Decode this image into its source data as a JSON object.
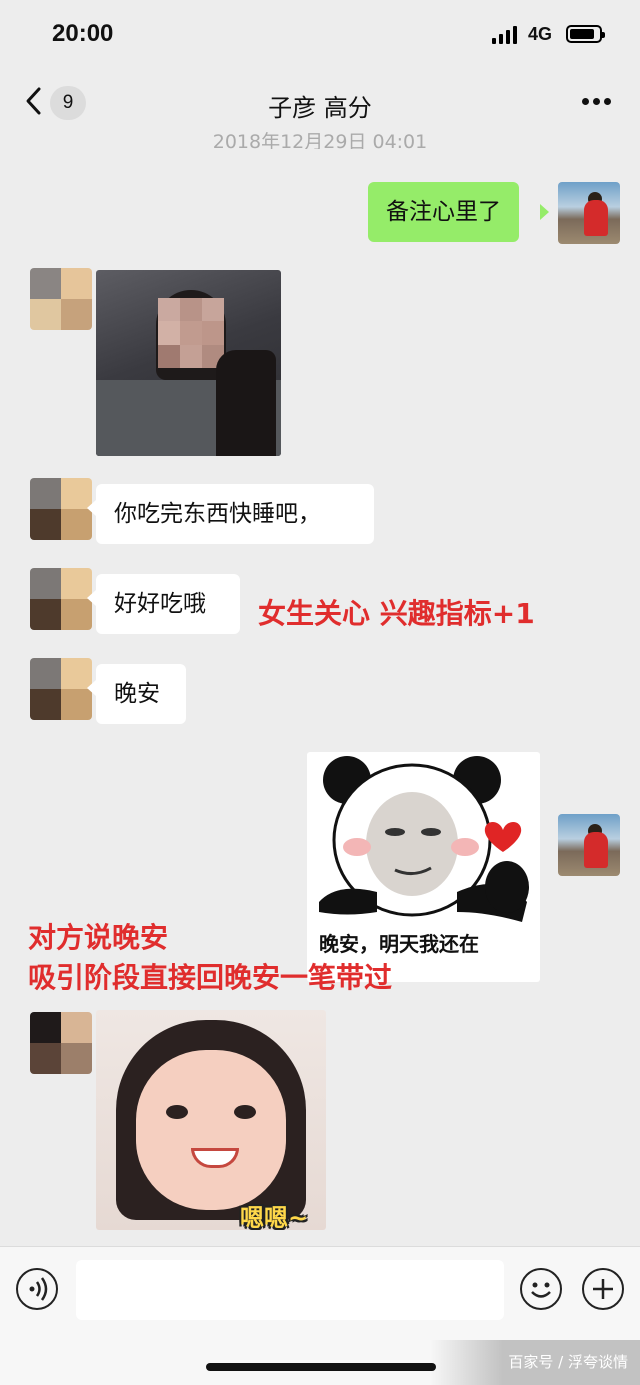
{
  "status_bar": {
    "time": "20:00",
    "network": "4G"
  },
  "nav": {
    "unread_count": "9",
    "title": "子彦 高分"
  },
  "timestamp": "2018年12月29日 04:01",
  "messages": {
    "m1": "备注心里了",
    "m3": "你吃完东西快睡吧，",
    "m4": "好好吃哦",
    "m5": "晚安",
    "sticker_caption": "晚安，明天我还在",
    "last_img_caption": "嗯嗯~"
  },
  "annotations": {
    "interest": "女生关心 兴趣指标+1",
    "goodnight_line1": "对方说晚安",
    "goodnight_line2": "吸引阶段直接回晚安一笔带过"
  },
  "watermark": "百家号 / 浮夸谈情",
  "icons": {
    "back": "chevron-left-icon",
    "more": "more-dots-icon",
    "voice": "voice-icon",
    "emoji": "emoji-icon",
    "plus": "plus-icon"
  },
  "colors": {
    "outgoing_bubble": "#95ec69",
    "annotation": "#e02d2d",
    "background": "#ededed"
  }
}
